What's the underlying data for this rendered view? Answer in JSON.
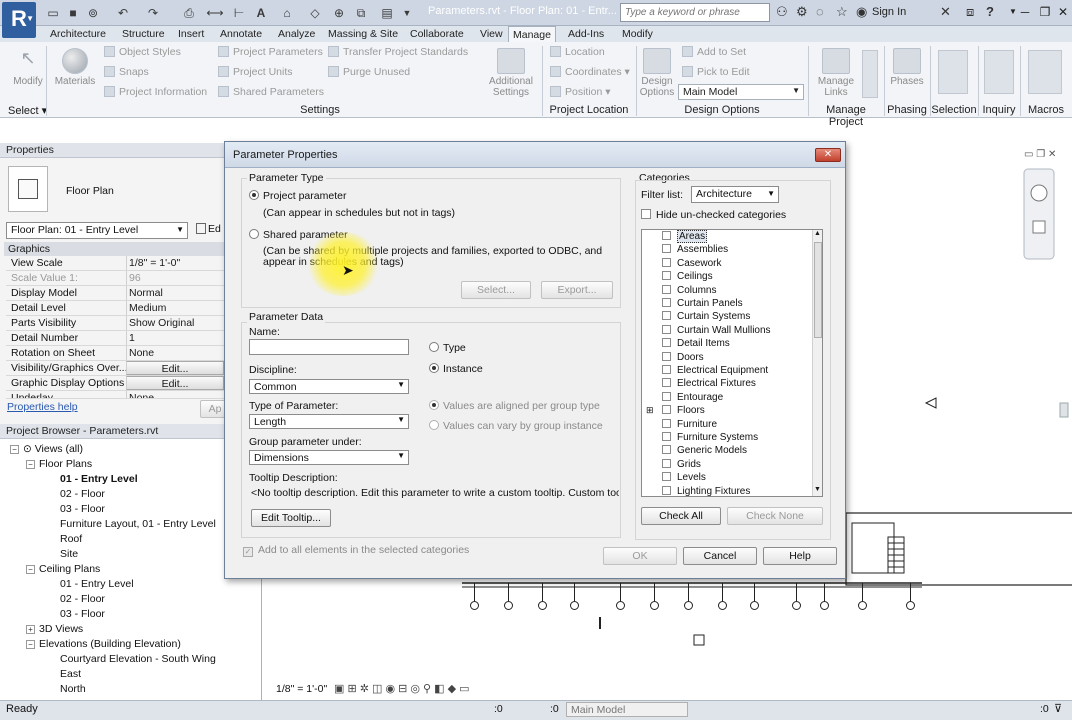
{
  "app": {
    "doc_title": "Parameters.rvt - Floor Plan: 01 - Entr...",
    "search_placeholder": "Type a keyword or phrase",
    "sign_in": "Sign In",
    "help_glyph": "?"
  },
  "ribbon": {
    "tabs": [
      "Architecture",
      "Structure",
      "Insert",
      "Annotate",
      "Analyze",
      "Massing & Site",
      "Collaborate",
      "View",
      "Manage",
      "Add-Ins",
      "Modify"
    ],
    "active_tab": "Manage",
    "modify": "Modify",
    "materials": "Materials",
    "settings_small": [
      "Object Styles",
      "Snaps",
      "Project Information",
      "Project Parameters",
      "Project Units",
      "Shared Parameters",
      "Transfer Project Standards",
      "Purge Unused"
    ],
    "additional_settings_1": "Additional",
    "additional_settings_2": "Settings",
    "location_small": [
      "Location",
      "Coordinates",
      "Position"
    ],
    "design_options_1": "Design",
    "design_options_2": "Options",
    "design_small": [
      "Add to Set",
      "Pick to Edit"
    ],
    "main_model": "Main Model",
    "manage_links_1": "Manage",
    "manage_links_2": "Links",
    "phases": "Phases",
    "panels": [
      "Select",
      "Settings",
      "Project Location",
      "Design Options",
      "Manage Project",
      "Phasing",
      "Selection",
      "Inquiry",
      "Macros"
    ]
  },
  "properties": {
    "title": "Properties",
    "type_name": "Floor Plan",
    "instance_selector": "Floor Plan: 01 - Entry Level",
    "edit_type": "Ed",
    "group": "Graphics",
    "rows": [
      {
        "k": "View Scale",
        "v": "1/8\" = 1'-0\""
      },
      {
        "k": "Scale Value    1:",
        "v": "96"
      },
      {
        "k": "Display Model",
        "v": "Normal"
      },
      {
        "k": "Detail Level",
        "v": "Medium"
      },
      {
        "k": "Parts Visibility",
        "v": "Show Original"
      },
      {
        "k": "Detail Number",
        "v": "1"
      },
      {
        "k": "Rotation on Sheet",
        "v": "None"
      },
      {
        "k": "Visibility/Graphics Over...",
        "v": "Edit..."
      },
      {
        "k": "Graphic Display Options",
        "v": "Edit..."
      },
      {
        "k": "Underlay",
        "v": "None"
      }
    ],
    "help_link": "Properties help",
    "apply": "Ap"
  },
  "browser": {
    "title": "Project Browser - Parameters.rvt",
    "items": [
      {
        "t": "Views (all)",
        "level": 0,
        "exp": "−"
      },
      {
        "t": "Floor Plans",
        "level": 1,
        "exp": "−"
      },
      {
        "t": "01 - Entry Level",
        "level": 2,
        "bold": true
      },
      {
        "t": "02 - Floor",
        "level": 2
      },
      {
        "t": "03 - Floor",
        "level": 2
      },
      {
        "t": "Furniture Layout,  01 - Entry Level",
        "level": 2
      },
      {
        "t": "Roof",
        "level": 2
      },
      {
        "t": "Site",
        "level": 2
      },
      {
        "t": "Ceiling Plans",
        "level": 1,
        "exp": "−"
      },
      {
        "t": "01 - Entry Level",
        "level": 2
      },
      {
        "t": "02 - Floor",
        "level": 2
      },
      {
        "t": "03 - Floor",
        "level": 2
      },
      {
        "t": "3D Views",
        "level": 1,
        "exp": "+"
      },
      {
        "t": "Elevations (Building Elevation)",
        "level": 1,
        "exp": "−"
      },
      {
        "t": "Courtyard Elevation - South Wing",
        "level": 2
      },
      {
        "t": "East",
        "level": 2
      },
      {
        "t": "North",
        "level": 2
      }
    ]
  },
  "status": {
    "ready": "Ready",
    "scale": "1/8\" = 1'-0\"",
    "zero1": ":0",
    "zero2": ":0",
    "main_model": "Main Model",
    "zero3": ":0"
  },
  "dialog": {
    "title": "Parameter Properties",
    "close": "✕",
    "param_type_label": "Parameter Type",
    "project_param": "Project parameter",
    "project_param_desc": "(Can appear in schedules but not in tags)",
    "shared_param": "Shared parameter",
    "shared_param_desc_1": "(Can be shared by multiple projects and families, exported to ODBC, and",
    "shared_param_desc_2": "appear in schedules and tags)",
    "select_btn": "Select...",
    "export_btn": "Export...",
    "param_data_label": "Parameter Data",
    "name_label": "Name:",
    "name_value": "",
    "type_radio": "Type",
    "instance_radio": "Instance",
    "discipline_label": "Discipline:",
    "discipline_value": "Common",
    "type_of_param_label": "Type of Parameter:",
    "type_of_param_value": "Length",
    "aligned": "Values are aligned per group type",
    "vary": "Values can vary by group instance",
    "group_label": "Group parameter under:",
    "group_value": "Dimensions",
    "tooltip_label": "Tooltip Description:",
    "tooltip_value": "<No tooltip description. Edit this parameter to write a custom tooltip. Custom tooltips hav...",
    "edit_tooltip_btn": "Edit Tooltip...",
    "add_all": "Add to all elements in the selected categories",
    "categories_label": "Categories",
    "filter_label": "Filter list:",
    "filter_value": "Architecture",
    "hide_unchecked": "Hide un-checked categories",
    "categories": [
      "Areas",
      "Assemblies",
      "Casework",
      "Ceilings",
      "Columns",
      "Curtain Panels",
      "Curtain Systems",
      "Curtain Wall Mullions",
      "Detail Items",
      "Doors",
      "Electrical Equipment",
      "Electrical Fixtures",
      "Entourage",
      "Floors",
      "Furniture",
      "Furniture Systems",
      "Generic Models",
      "Grids",
      "Levels",
      "Lighting Fixtures"
    ],
    "check_all": "Check All",
    "check_none": "Check None",
    "ok": "OK",
    "cancel": "Cancel",
    "help": "Help"
  },
  "colors": {
    "accent": "#2f5f9e",
    "highlight": "#fff228",
    "close_red": "#c2402c"
  },
  "icons": [
    "revit-logo-icon",
    "open-icon",
    "save-icon",
    "undo-icon",
    "redo-icon",
    "print-icon",
    "measure-icon",
    "text-icon",
    "3d-icon",
    "binoculars-icon",
    "star-icon",
    "user-icon",
    "exchange-icon",
    "help-icon",
    "close-icon",
    "chevron-down-icon",
    "expand-icon",
    "checkbox-icon"
  ]
}
